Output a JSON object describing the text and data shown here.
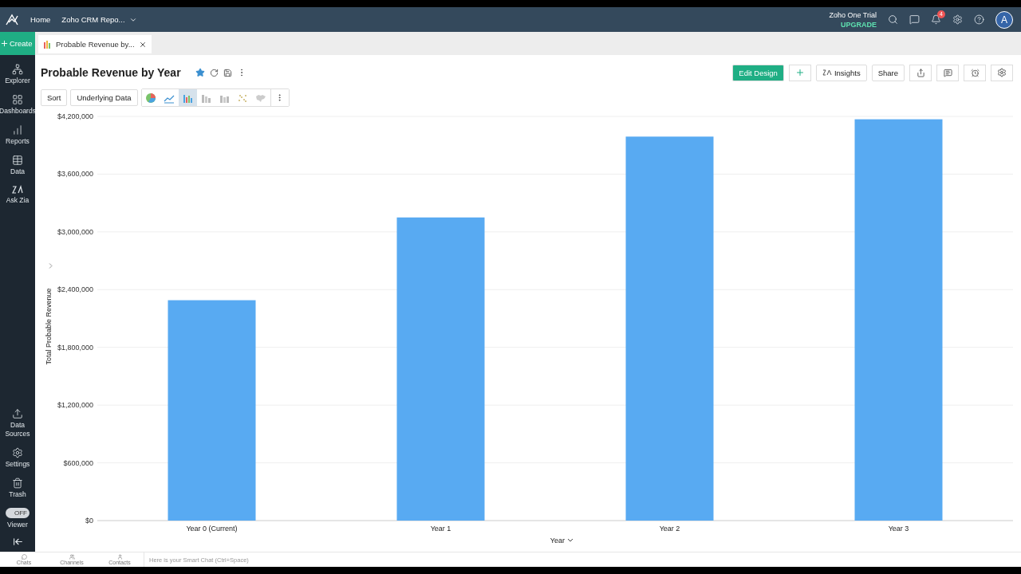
{
  "header": {
    "nav": [
      "Home",
      "Zoho CRM Repo..."
    ],
    "trial": "Zoho One Trial",
    "upgrade": "UPGRADE",
    "notifications": "4",
    "avatar": "A"
  },
  "create": "Create",
  "tabs": [
    {
      "label": "Probable Revenue by...",
      "selected": true
    }
  ],
  "sidebar": {
    "top": [
      {
        "label": "Explorer",
        "kind": "explorer"
      },
      {
        "label": "Dashboards",
        "kind": "dashboards"
      },
      {
        "label": "Reports",
        "kind": "reports"
      },
      {
        "label": "Data",
        "kind": "data"
      },
      {
        "label": "Ask Zia",
        "kind": "zia"
      }
    ],
    "bottom": [
      {
        "label": "Data Sources",
        "kind": "sources"
      },
      {
        "label": "Settings",
        "kind": "settings"
      },
      {
        "label": "Trash",
        "kind": "trash"
      }
    ],
    "viewer": {
      "label": "Viewer",
      "toggle": "OFF",
      "on": false
    }
  },
  "report": {
    "title": "Probable Revenue by Year",
    "favorite": true,
    "actions": [
      {
        "label": "Edit Design",
        "kind": "primary"
      },
      {
        "kind": "plus"
      },
      {
        "label": "Insights",
        "kind": "insights"
      },
      {
        "label": "Share",
        "kind": "plain"
      }
    ],
    "toolbar": [
      "Sort",
      "Underlying Data"
    ],
    "chart_types": [
      {
        "kind": "pie",
        "selected": false
      },
      {
        "kind": "line",
        "selected": false
      },
      {
        "kind": "bar",
        "selected": true
      },
      {
        "kind": "stacked",
        "selected": false
      },
      {
        "kind": "column",
        "selected": false
      },
      {
        "kind": "scatter",
        "selected": false
      },
      {
        "kind": "map",
        "selected": false
      }
    ],
    "chart_data": {
      "type": "bar",
      "xlabel": "Year",
      "ylabel": "Total Probable Revenue",
      "categories": [
        "Year 0 (Current)",
        "Year 1",
        "Year 2",
        "Year 3"
      ],
      "series": [
        {
          "color": "#58aaf2",
          "values": [
            2290000,
            3150000,
            3990000,
            4170000
          ]
        }
      ],
      "grid": true,
      "ylim": [
        0,
        4200000
      ],
      "yticks": [
        {
          "value": 0,
          "label": "$0"
        },
        {
          "value": 600000,
          "label": "$600,000"
        },
        {
          "value": 1200000,
          "label": "$1,200,000"
        },
        {
          "value": 1800000,
          "label": "$1,800,000"
        },
        {
          "value": 2400000,
          "label": "$2,400,000"
        },
        {
          "value": 3000000,
          "label": "$3,000,000"
        },
        {
          "value": 3600000,
          "label": "$3,600,000"
        },
        {
          "value": 4200000,
          "label": "$4,200,000"
        }
      ]
    }
  },
  "chat": {
    "items": [
      "Chats",
      "Channels",
      "Contacts"
    ],
    "placeholder": "Here is your Smart Chat (Ctrl+Space)"
  }
}
